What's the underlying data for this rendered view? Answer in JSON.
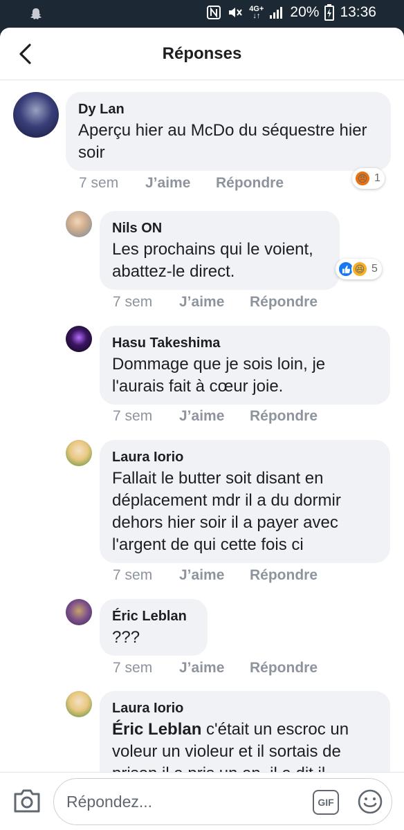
{
  "status_bar": {
    "signal_text": "4G+",
    "battery": "20%",
    "time": "13:36"
  },
  "header": {
    "title": "Réponses"
  },
  "comments": [
    {
      "author": "Dy Lan",
      "text": "Aperçu hier au McDo du séquestre hier soir",
      "time": "7 sem",
      "like": "J’aime",
      "reply": "Répondre",
      "reactions": {
        "icons": [
          "angry-reaction-icon"
        ],
        "count": "1"
      }
    },
    {
      "author": "Nils ON",
      "text": "Les prochains qui le voient, abattez-le direct.",
      "time": "7 sem",
      "like": "J’aime",
      "reply": "Répondre",
      "reactions": {
        "icons": [
          "like-reaction-icon",
          "haha-reaction-icon"
        ],
        "count": "5"
      }
    },
    {
      "author": "Hasu Takeshima",
      "text": "Dommage que je sois loin, je l'aurais fait à cœur joie.",
      "time": "7 sem",
      "like": "J’aime",
      "reply": "Répondre"
    },
    {
      "author": "Laura Iorio",
      "text": "Fallait le butter soit disant en déplacement mdr il a du dormir dehors hier soir il a payer avec l'argent de qui cette fois ci",
      "time": "7 sem",
      "like": "J’aime",
      "reply": "Répondre"
    },
    {
      "author": "Éric Leblan",
      "text": "???",
      "time": "7 sem",
      "like": "J’aime",
      "reply": "Répondre"
    },
    {
      "author": "Laura Iorio",
      "mention": "Éric Leblan",
      "text": " c'était un escroc un voleur un violeur et il sortais de",
      "partial_text": "prison il a pris un an, il a dit il",
      "time": "",
      "like": "",
      "reply": ""
    }
  ],
  "composer": {
    "placeholder": "Répondez...",
    "gif_label": "GIF"
  },
  "colors": {
    "bubble": "#f0f2f5",
    "meta": "#8d949e",
    "like_blue": "#1877f2",
    "haha_yellow": "#f7b125",
    "angry_orange": "#e9710f"
  }
}
